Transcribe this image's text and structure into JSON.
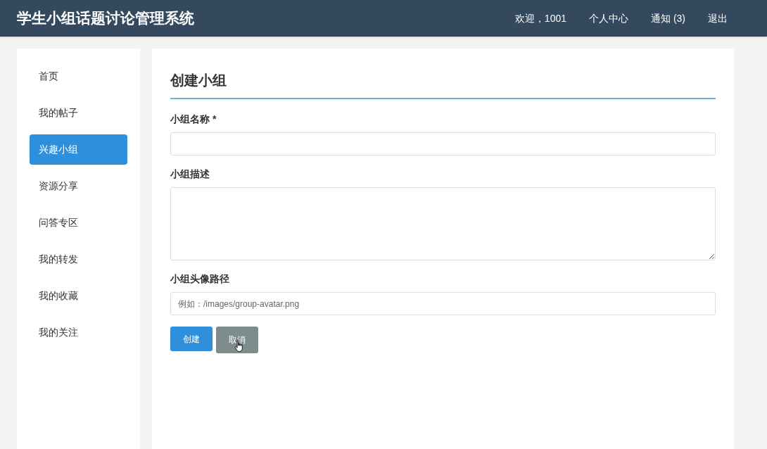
{
  "header": {
    "title": "学生小组话题讨论管理系统",
    "nav": [
      {
        "label": "欢迎，1001"
      },
      {
        "label": "个人中心"
      },
      {
        "label": "通知 (3)"
      },
      {
        "label": "退出"
      }
    ]
  },
  "sidebar": {
    "items": [
      {
        "label": "首页",
        "selected": false
      },
      {
        "label": "我的帖子",
        "selected": false
      },
      {
        "label": "兴趣小组",
        "selected": true
      },
      {
        "label": "资源分享",
        "selected": false
      },
      {
        "label": "问答专区",
        "selected": false
      },
      {
        "label": "我的转发",
        "selected": false
      },
      {
        "label": "我的收藏",
        "selected": false
      },
      {
        "label": "我的关注",
        "selected": false
      }
    ]
  },
  "form": {
    "title": "创建小组",
    "fields": [
      {
        "kind": "input",
        "label": "小组名称 *"
      },
      {
        "kind": "textarea",
        "label": "小组描述"
      },
      {
        "kind": "input",
        "label": "小组头像路径",
        "placeholder": "例如：/images/group-avatar.png"
      }
    ],
    "buttons": [
      {
        "kind": "primary",
        "label": "创建"
      },
      {
        "kind": "secondary",
        "label": "取消"
      }
    ]
  }
}
